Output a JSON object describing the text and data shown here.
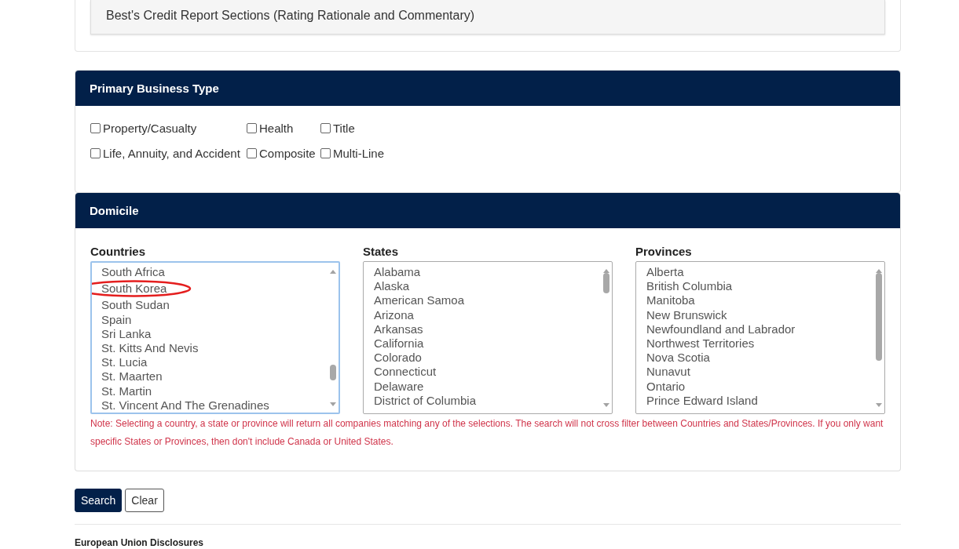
{
  "report_sections": {
    "item": "Best's Credit Report Sections (Rating Rationale and Commentary)"
  },
  "primary_business_type": {
    "title": "Primary Business Type",
    "rows": [
      [
        {
          "label": "Property/Casualty",
          "checked": false
        },
        {
          "label": "Health",
          "checked": false
        },
        {
          "label": "Title",
          "checked": false
        }
      ],
      [
        {
          "label": "Life, Annuity, and Accident",
          "checked": false
        },
        {
          "label": "Composite",
          "checked": false
        },
        {
          "label": "Multi-Line",
          "checked": false
        }
      ]
    ]
  },
  "domicile": {
    "title": "Domicile",
    "lists": [
      {
        "label": "Countries",
        "focused": true,
        "items": [
          {
            "text": "South Africa",
            "circled": false
          },
          {
            "text": "South Korea",
            "circled": true
          },
          {
            "text": "South Sudan",
            "circled": false
          },
          {
            "text": "Spain",
            "circled": false
          },
          {
            "text": "Sri Lanka",
            "circled": false
          },
          {
            "text": "St. Kitts And Nevis",
            "circled": false
          },
          {
            "text": "St. Lucia",
            "circled": false
          },
          {
            "text": "St. Maarten",
            "circled": false
          },
          {
            "text": "St. Martin",
            "circled": false
          },
          {
            "text": "St. Vincent And The Grenadines",
            "circled": false
          }
        ]
      },
      {
        "label": "States",
        "focused": false,
        "items": [
          {
            "text": "Alabama",
            "circled": false
          },
          {
            "text": "Alaska",
            "circled": false
          },
          {
            "text": "American Samoa",
            "circled": false
          },
          {
            "text": "Arizona",
            "circled": false
          },
          {
            "text": "Arkansas",
            "circled": false
          },
          {
            "text": "California",
            "circled": false
          },
          {
            "text": "Colorado",
            "circled": false
          },
          {
            "text": "Connecticut",
            "circled": false
          },
          {
            "text": "Delaware",
            "circled": false
          },
          {
            "text": "District of Columbia",
            "circled": false
          }
        ]
      },
      {
        "label": "Provinces",
        "focused": false,
        "items": [
          {
            "text": "Alberta",
            "circled": false
          },
          {
            "text": "British Columbia",
            "circled": false
          },
          {
            "text": "Manitoba",
            "circled": false
          },
          {
            "text": "New Brunswick",
            "circled": false
          },
          {
            "text": "Newfoundland and Labrador",
            "circled": false
          },
          {
            "text": "Northwest Territories",
            "circled": false
          },
          {
            "text": "Nova Scotia",
            "circled": false
          },
          {
            "text": "Nunavut",
            "circled": false
          },
          {
            "text": "Ontario",
            "circled": false
          },
          {
            "text": "Prince Edward Island",
            "circled": false
          }
        ]
      }
    ],
    "note": "Note: Selecting a country, a state or province will return all companies matching any of the selections. The search will not cross filter between Countries and States/Provinces. If you only want specific States or Provinces, then don't include Canada or United States."
  },
  "buttons": [
    {
      "label": "Search",
      "kind": "primary"
    },
    {
      "label": "Clear",
      "kind": "secondary"
    }
  ],
  "footer_heading": "European Union Disclosures"
}
